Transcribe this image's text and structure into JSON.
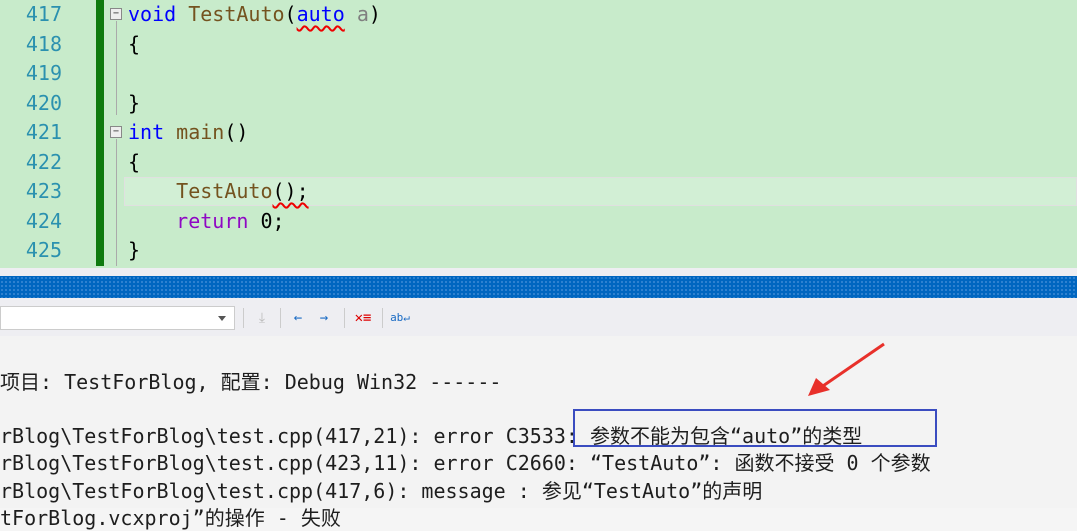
{
  "editor": {
    "lines": [
      {
        "num": "417"
      },
      {
        "num": "418",
        "text": "{"
      },
      {
        "num": "419"
      },
      {
        "num": "420",
        "text": "}"
      },
      {
        "num": "421"
      },
      {
        "num": "422",
        "text": "{"
      },
      {
        "num": "423"
      },
      {
        "num": "424"
      },
      {
        "num": "425",
        "text": "}"
      }
    ],
    "l417": {
      "kw": "void",
      "fn": "TestAuto",
      "open": "(",
      "type": "auto",
      "param": "a",
      "close": ")"
    },
    "l421": {
      "kw": "int",
      "fn": "main",
      "rest": "()"
    },
    "l423": {
      "fn": "TestAuto",
      "rest": "();"
    },
    "l424": {
      "kw": "return",
      "rest": " 0;"
    }
  },
  "output": {
    "lines": [
      "项目: TestForBlog, 配置: Debug Win32 ------",
      "rBlog\\TestForBlog\\test.cpp(417,21): error C3533: 参数不能为包含“auto”的类型",
      "rBlog\\TestForBlog\\test.cpp(423,11): error C2660: “TestAuto”: 函数不接受 0 个参数",
      "rBlog\\TestForBlog\\test.cpp(417,6): message : 参见“TestAuto”的声明",
      "tForBlog.vcxproj”的操作 - 失败"
    ]
  },
  "colors": {
    "highlight_box": "#3a4cc0",
    "arrow": "#e8302a"
  }
}
